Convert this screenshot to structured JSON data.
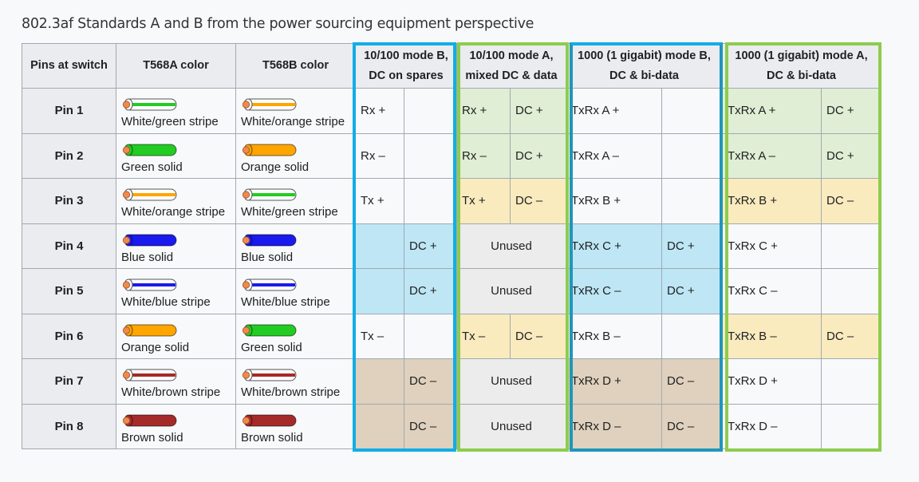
{
  "caption": "802.3af Standards A and B from the power sourcing equipment perspective",
  "colors": {
    "frame_blue": "#12ade6",
    "frame_green": "#8dcc4e",
    "cell_green": "#dfeed4",
    "cell_yellow": "#f9ebbe",
    "cell_blue": "#bee6f5",
    "cell_tan": "#dfd1bd",
    "cell_gray": "#ececec"
  },
  "headers": {
    "pins": "Pins at switch",
    "t568a": "T568A color",
    "t568b": "T568B color",
    "mode_b_100_line1": "10/100 mode B,",
    "mode_b_100_line2": "DC on spares",
    "mode_a_100_line1": "10/100 mode A,",
    "mode_a_100_line2": "mixed DC & data",
    "mode_b_1000_line1": "1000 (1 gigabit) mode B,",
    "mode_b_1000_line2": "DC & bi-data",
    "mode_a_1000_line1": "1000 (1 gigabit) mode A,",
    "mode_a_1000_line2": "DC & bi-data"
  },
  "rows": [
    {
      "pin": "Pin 1",
      "t568a": {
        "label": "White/green stripe",
        "icon": "wire-white-green-stripe",
        "base": "#ffffff",
        "stripe": "#22cc22"
      },
      "t568b": {
        "label": "White/orange stripe",
        "icon": "wire-white-orange-stripe",
        "base": "#ffffff",
        "stripe": "#ffa500"
      },
      "b100": [
        "Rx +",
        ""
      ],
      "a100": [
        "Rx +",
        "DC +"
      ],
      "b1000": [
        "TxRx A +",
        ""
      ],
      "a1000": [
        "TxRx A +",
        "DC +"
      ]
    },
    {
      "pin": "Pin 2",
      "t568a": {
        "label": "Green solid",
        "icon": "wire-green-solid",
        "base": "#22cc22",
        "stripe": null
      },
      "t568b": {
        "label": "Orange solid",
        "icon": "wire-orange-solid",
        "base": "#ffa500",
        "stripe": null
      },
      "b100": [
        "Rx –",
        ""
      ],
      "a100": [
        "Rx –",
        "DC +"
      ],
      "b1000": [
        "TxRx A –",
        ""
      ],
      "a1000": [
        "TxRx A –",
        "DC +"
      ]
    },
    {
      "pin": "Pin 3",
      "t568a": {
        "label": "White/orange stripe",
        "icon": "wire-white-orange-stripe",
        "base": "#ffffff",
        "stripe": "#ffa500"
      },
      "t568b": {
        "label": "White/green stripe",
        "icon": "wire-white-green-stripe",
        "base": "#ffffff",
        "stripe": "#22cc22"
      },
      "b100": [
        "Tx +",
        ""
      ],
      "a100": [
        "Tx +",
        "DC –"
      ],
      "b1000": [
        "TxRx B +",
        ""
      ],
      "a1000": [
        "TxRx B +",
        "DC –"
      ]
    },
    {
      "pin": "Pin 4",
      "t568a": {
        "label": "Blue solid",
        "icon": "wire-blue-solid",
        "base": "#1a1aee",
        "stripe": null
      },
      "t568b": {
        "label": "Blue solid",
        "icon": "wire-blue-solid",
        "base": "#1a1aee",
        "stripe": null
      },
      "b100": [
        "",
        "DC +"
      ],
      "a100": [
        "Unused"
      ],
      "b1000": [
        "TxRx C +",
        "DC +"
      ],
      "a1000": [
        "TxRx C +",
        ""
      ]
    },
    {
      "pin": "Pin 5",
      "t568a": {
        "label": "White/blue stripe",
        "icon": "wire-white-blue-stripe",
        "base": "#ffffff",
        "stripe": "#1a1aee"
      },
      "t568b": {
        "label": "White/blue stripe",
        "icon": "wire-white-blue-stripe",
        "base": "#ffffff",
        "stripe": "#1a1aee"
      },
      "b100": [
        "",
        "DC +"
      ],
      "a100": [
        "Unused"
      ],
      "b1000": [
        "TxRx C –",
        "DC +"
      ],
      "a1000": [
        "TxRx C –",
        ""
      ]
    },
    {
      "pin": "Pin 6",
      "t568a": {
        "label": "Orange solid",
        "icon": "wire-orange-solid",
        "base": "#ffa500",
        "stripe": null
      },
      "t568b": {
        "label": "Green solid",
        "icon": "wire-green-solid",
        "base": "#22cc22",
        "stripe": null
      },
      "b100": [
        "Tx –",
        ""
      ],
      "a100": [
        "Tx –",
        "DC –"
      ],
      "b1000": [
        "TxRx B –",
        ""
      ],
      "a1000": [
        "TxRx B –",
        "DC –"
      ]
    },
    {
      "pin": "Pin 7",
      "t568a": {
        "label": "White/brown stripe",
        "icon": "wire-white-brown-stripe",
        "base": "#ffffff",
        "stripe": "#a52a2a"
      },
      "t568b": {
        "label": "White/brown stripe",
        "icon": "wire-white-brown-stripe",
        "base": "#ffffff",
        "stripe": "#a52a2a"
      },
      "b100": [
        "",
        "DC –"
      ],
      "a100": [
        "Unused"
      ],
      "b1000": [
        "TxRx D +",
        "DC –"
      ],
      "a1000": [
        "TxRx D +",
        ""
      ]
    },
    {
      "pin": "Pin 8",
      "t568a": {
        "label": "Brown solid",
        "icon": "wire-brown-solid",
        "base": "#a52a2a",
        "stripe": null
      },
      "t568b": {
        "label": "Brown solid",
        "icon": "wire-brown-solid",
        "base": "#a52a2a",
        "stripe": null
      },
      "b100": [
        "",
        "DC –"
      ],
      "a100": [
        "Unused"
      ],
      "b1000": [
        "TxRx D –",
        "DC –"
      ],
      "a1000": [
        "TxRx D –",
        ""
      ]
    }
  ],
  "row_fills": {
    "b100": [
      "",
      "",
      "",
      "blue",
      "blue",
      "",
      "tan",
      "tan"
    ],
    "a100": [
      "green",
      "green",
      "yellow",
      "gray",
      "gray",
      "yellow",
      "gray",
      "gray"
    ],
    "b1000": [
      "",
      "",
      "",
      "blue",
      "blue",
      "",
      "tan",
      "tan"
    ],
    "a1000": [
      "green",
      "green",
      "yellow",
      "",
      "",
      "yellow",
      "",
      ""
    ]
  }
}
